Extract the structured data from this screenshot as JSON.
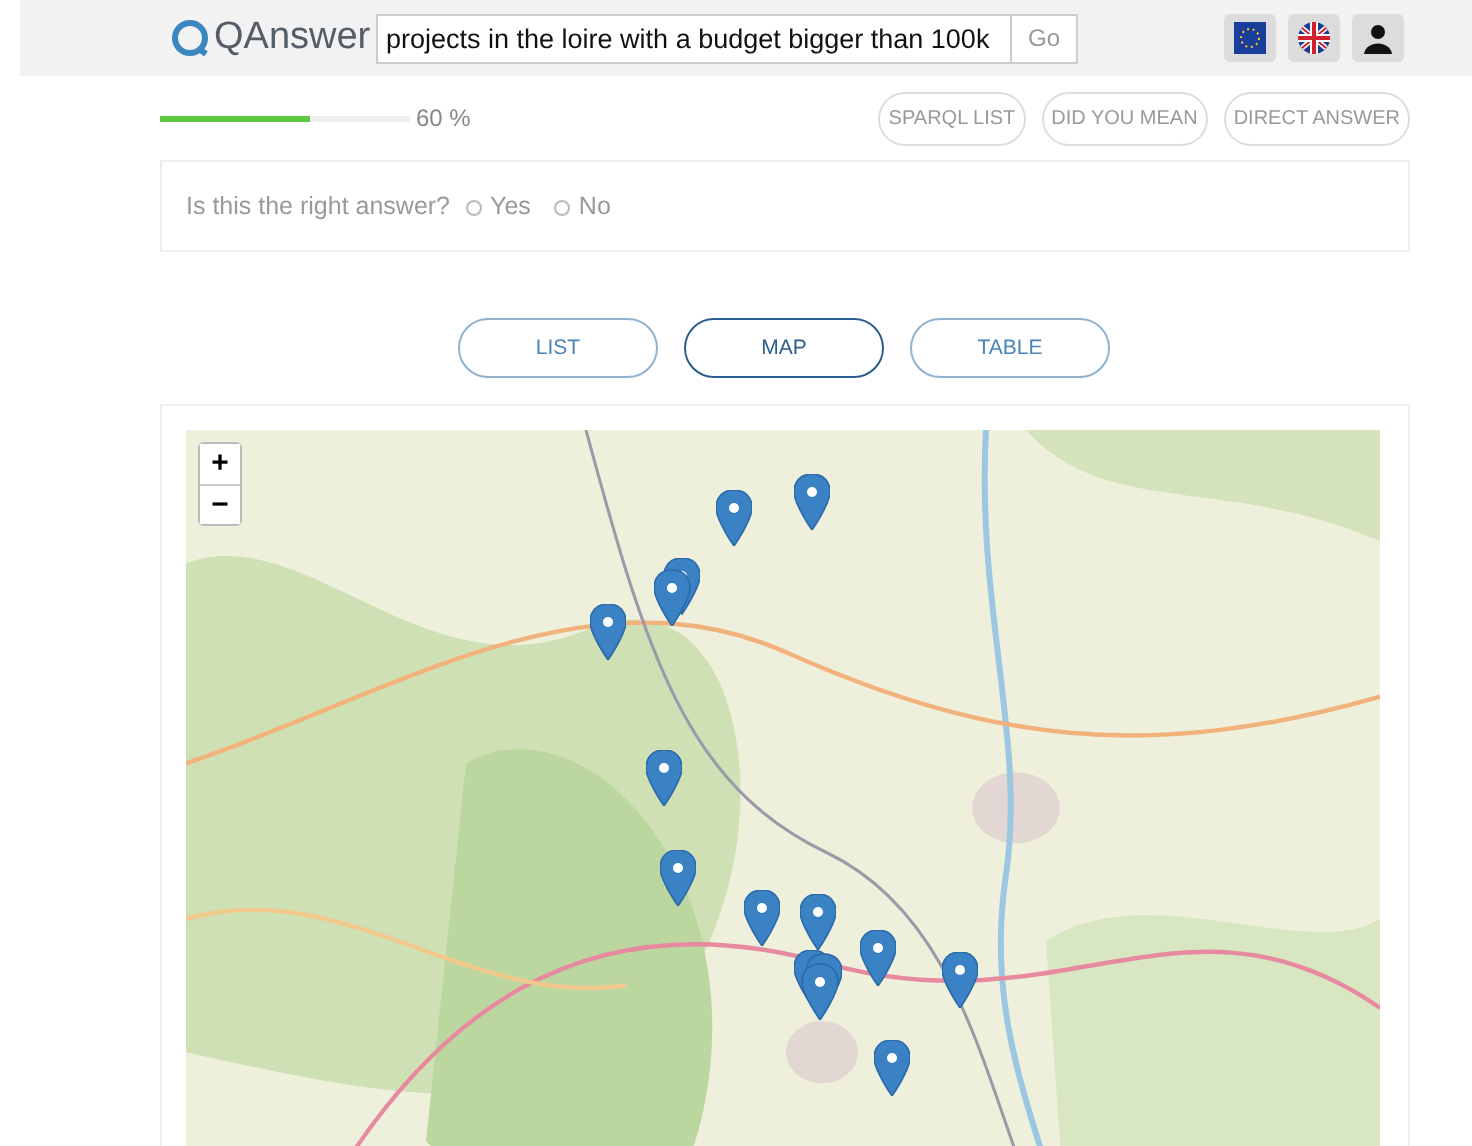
{
  "header": {
    "logo": "QAnswer",
    "search": {
      "value": "projects in the loire with a budget bigger than 100k"
    },
    "go_button": "Go"
  },
  "progress": {
    "level": 0.6,
    "label": "60 %"
  },
  "actions": [
    "SPARQL LIST",
    "DID YOU MEAN",
    "DIRECT ANSWER"
  ],
  "feedback": {
    "question": "Is this the right answer?",
    "options": [
      {
        "label": "Yes",
        "selected": false
      },
      {
        "label": "No",
        "selected": false
      }
    ]
  },
  "views": [
    {
      "label": "LIST",
      "selected": false
    },
    {
      "label": "MAP",
      "selected": true
    },
    {
      "label": "TABLE",
      "selected": false
    }
  ],
  "map": {
    "kind": "picture",
    "zoom_in": "+",
    "zoom_out": "−"
  }
}
